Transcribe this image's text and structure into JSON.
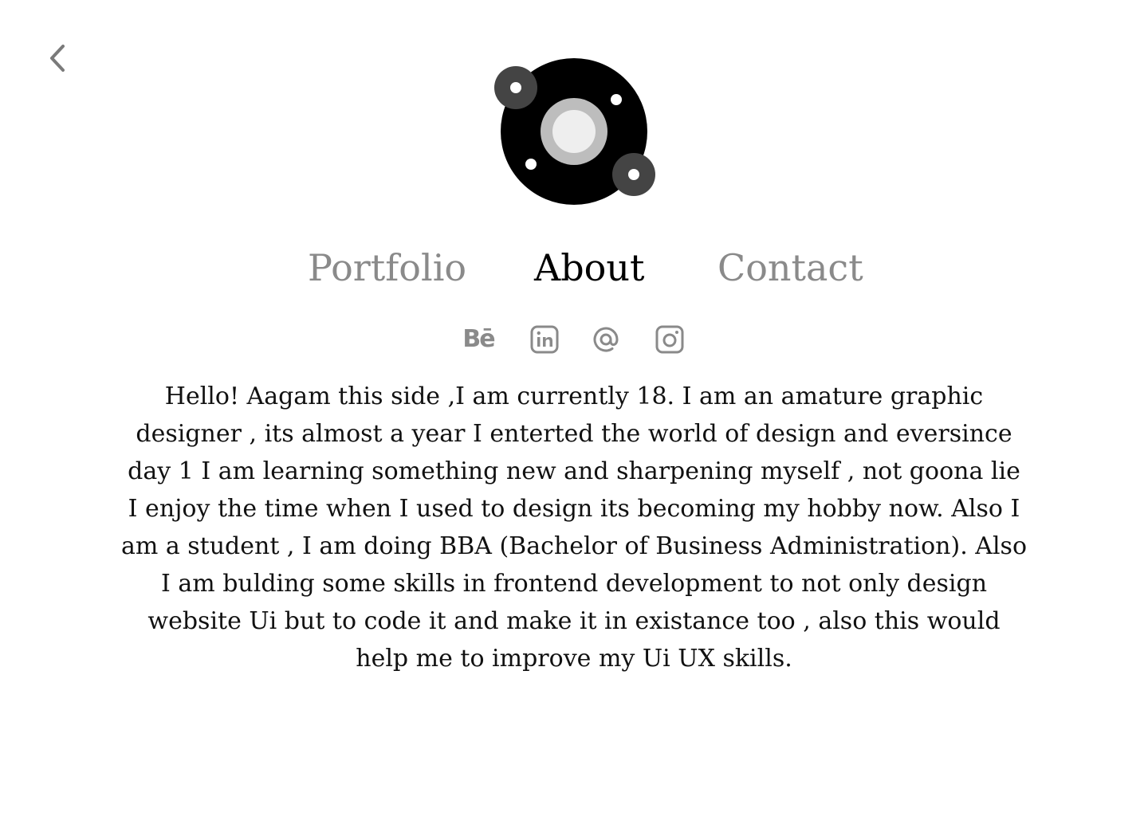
{
  "header": {
    "back_icon": "chevron-left-icon",
    "logo_icon": "orbit-logo-icon"
  },
  "nav": {
    "items": [
      {
        "label": "Portfolio",
        "active": false
      },
      {
        "label": "About",
        "active": true
      },
      {
        "label": "Contact",
        "active": false
      }
    ]
  },
  "socials": {
    "behance_label": "Bē",
    "icons": [
      "behance-icon",
      "linkedin-icon",
      "email-at-icon",
      "instagram-icon"
    ]
  },
  "about": {
    "bio": "Hello! Aagam this side ,I am currently 18. I am an amature graphic designer , its almost a year I enterted the world of design and eversince day 1 I am learning something new and sharpening myself , not goona lie I enjoy the time when I used to design its becoming my hobby now. Also I am a student , I am doing BBA (Bachelor of Business Administration). Also I am bulding some skills in frontend development to not only design website Ui but to code it and make it in existance too , also this would help me to improve my Ui UX skills."
  },
  "colors": {
    "active_text": "#000000",
    "inactive_text": "#8a8a8a",
    "background": "#ffffff"
  }
}
